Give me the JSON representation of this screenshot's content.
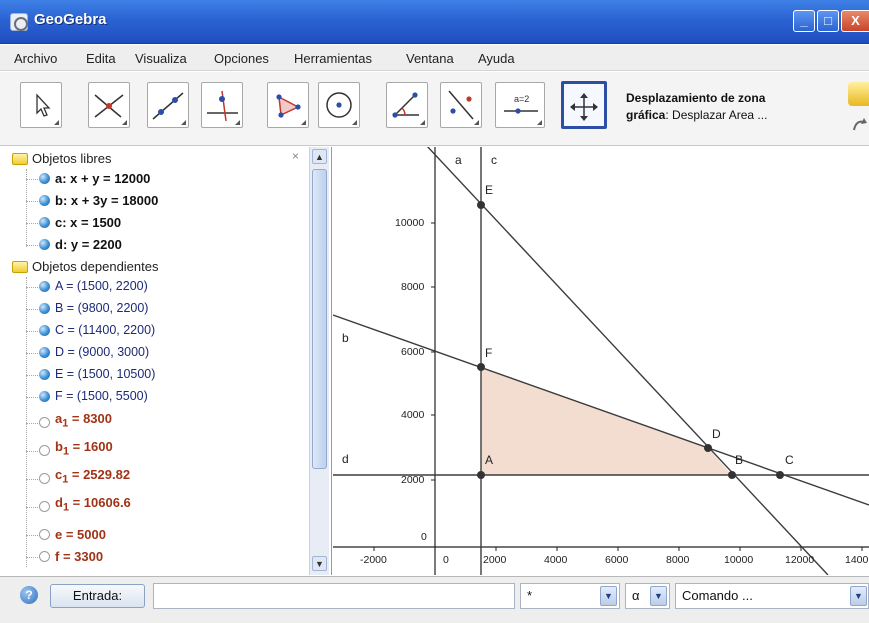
{
  "window": {
    "title": "GeoGebra",
    "minimize_label": "_",
    "maximize_label": "□",
    "close_label": "X"
  },
  "menu": [
    "Archivo",
    "Edita",
    "Visualiza",
    "Opciones",
    "Herramientas",
    "Ventana",
    "Ayuda"
  ],
  "toolbar": {
    "tools": [
      {
        "icon": "pointer-icon"
      },
      {
        "icon": "intersect-icon"
      },
      {
        "icon": "line-through-points-icon"
      },
      {
        "icon": "perpendicular-line-icon"
      },
      {
        "icon": "polygon-icon"
      },
      {
        "icon": "circle-icon"
      },
      {
        "icon": "angle-icon"
      },
      {
        "icon": "reflect-icon"
      },
      {
        "icon": "slider-icon",
        "text": "a=2"
      },
      {
        "icon": "move-graphics-view-icon",
        "selected": true
      }
    ],
    "description_title": "Desplazamiento de zona",
    "description_text_bold": "gráfica",
    "description_text": ": Desplazar Area ..."
  },
  "algebra": {
    "close_label": "×",
    "free_title": "Objetos libres",
    "free": [
      "a: x + y = 12000",
      "b: x + 3y = 18000",
      "c: x = 1500",
      "d: y = 2200"
    ],
    "dependent_title": "Objetos dependientes",
    "points": [
      "A = (1500, 2200)",
      "B = (9800, 2200)",
      "C = (11400, 2200)",
      "D = (9000, 3000)",
      "E = (1500, 10500)",
      "F = (1500, 5500)"
    ],
    "numbers": [
      {
        "name": "a",
        "sub": "1",
        "value": " = 8300"
      },
      {
        "name": "b",
        "sub": "1",
        "value": " = 1600"
      },
      {
        "name": "c",
        "sub": "1",
        "value": " = 2529.82"
      },
      {
        "name": "d",
        "sub": "1",
        "value": " = 10606.6"
      },
      {
        "name": "e",
        "sub": "",
        "value": " = 5000"
      },
      {
        "name": "f",
        "sub": "",
        "value": " = 3300"
      }
    ]
  },
  "graphics": {
    "x_ticks": [
      "-2000",
      "0",
      "2000",
      "4000",
      "6000",
      "8000",
      "10000",
      "12000",
      "1400"
    ],
    "y_ticks": [
      "10000",
      "8000",
      "6000",
      "4000",
      "2000",
      "0"
    ],
    "line_labels": {
      "a": "a",
      "b": "b",
      "c": "c",
      "d": "d"
    },
    "point_labels": {
      "A": "A",
      "B": "B",
      "C": "C",
      "D": "D",
      "E": "E",
      "F": "F"
    },
    "colors": {
      "region": "#f3ddd0",
      "line": "#3c3c3c",
      "axis": "#222222"
    }
  },
  "inputbar": {
    "help_icon": "?",
    "entrada_label": "Entrada:",
    "input_value": "",
    "symbol_value": "*",
    "greek_value": "α",
    "command_value": "Comando ..."
  }
}
